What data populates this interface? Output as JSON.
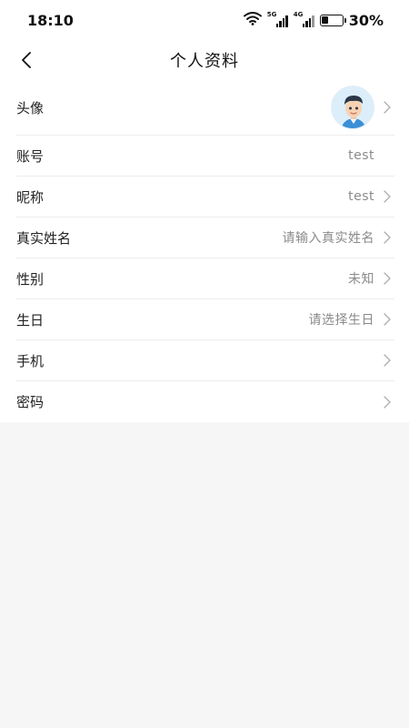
{
  "status_bar": {
    "time": "18:10",
    "network_5g": "5G",
    "network_4g": "4G",
    "battery": "30%",
    "battery_level": 0.3
  },
  "nav": {
    "title": "个人资料",
    "back_icon": "chevron-left-icon"
  },
  "profile": {
    "avatar_label": "头像",
    "avatar_icon": "user-avatar",
    "account_label": "账号",
    "account_value": "test",
    "nickname_label": "昵称",
    "nickname_value": "test",
    "realname_label": "真实姓名",
    "realname_placeholder": "请输入真实姓名",
    "gender_label": "性别",
    "gender_value": "未知",
    "birthday_label": "生日",
    "birthday_placeholder": "请选择生日",
    "phone_label": "手机",
    "phone_value": "",
    "password_label": "密码"
  },
  "colors": {
    "background": "#f6f6f6",
    "card": "#ffffff",
    "divider": "#ececec",
    "value_text": "#8a8a8a",
    "chevron": "#b0b0b0"
  }
}
